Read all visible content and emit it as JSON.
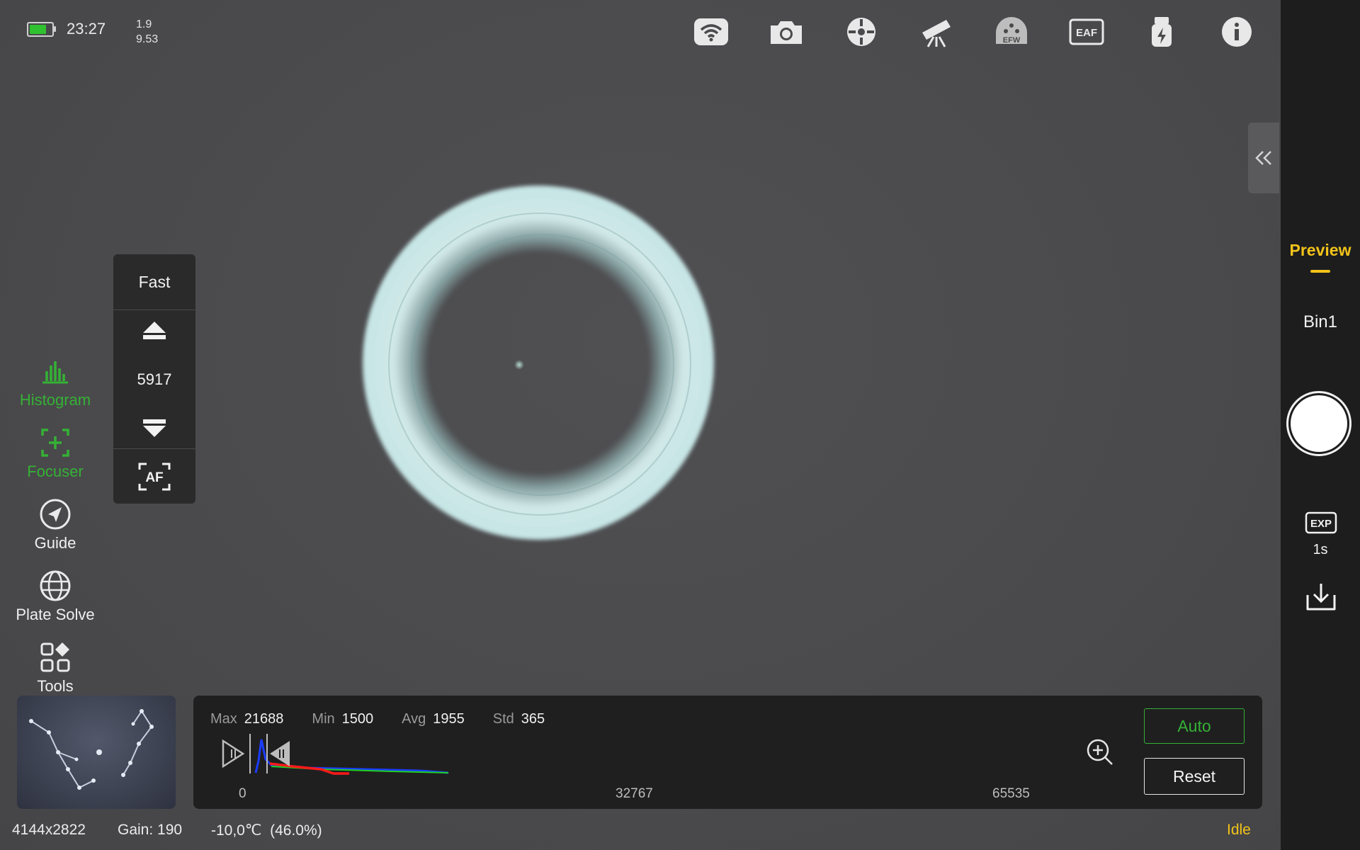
{
  "status": {
    "battery_level": 0.9,
    "battery_color": "#2fc12f",
    "time": "23:27",
    "value_top": "1.9",
    "value_bottom": "9.53"
  },
  "top_icons": [
    "wifi-icon",
    "camera-icon",
    "mount-crosshair-icon",
    "telescope-icon",
    "efw-filter-wheel-icon",
    "eaf-focuser-icon",
    "usb-drive-icon",
    "info-icon"
  ],
  "top_icon_labels": {
    "efw": "EFW",
    "eaf": "EAF"
  },
  "left_menu": [
    {
      "label": "Histogram",
      "icon": "histogram-icon",
      "active": true
    },
    {
      "label": "Focuser",
      "icon": "focuser-icon",
      "active": true
    },
    {
      "label": "Guide",
      "icon": "guide-icon",
      "active": false
    },
    {
      "label": "Plate Solve",
      "icon": "globe-icon",
      "active": false
    },
    {
      "label": "Tools",
      "icon": "tools-grid-icon",
      "active": false
    }
  ],
  "focuser": {
    "speed": "Fast",
    "position": "5917",
    "af_label": "AF"
  },
  "right_bar": {
    "mode": "Preview",
    "binning": "Bin1",
    "exp_label": "EXP",
    "exposure": "1s"
  },
  "histogram": {
    "max_label": "Max",
    "max_value": "21688",
    "min_label": "Min",
    "min_value": "1500",
    "avg_label": "Avg",
    "avg_value": "1955",
    "std_label": "Std",
    "std_value": "365",
    "tick_start": "0",
    "tick_mid": "32767",
    "tick_end": "65535",
    "auto_label": "Auto",
    "reset_label": "Reset",
    "colors": {
      "red": "#ff1a1a",
      "green": "#1fd11f",
      "blue": "#1a3cff"
    }
  },
  "bottom_info": {
    "resolution": "4144x2822",
    "gain": "Gain: 190",
    "temperature": "-10,0℃  (46.0%)",
    "state": "Idle"
  },
  "accent_colors": {
    "active_green": "#35b135",
    "preview_yellow": "#f2c31a"
  }
}
